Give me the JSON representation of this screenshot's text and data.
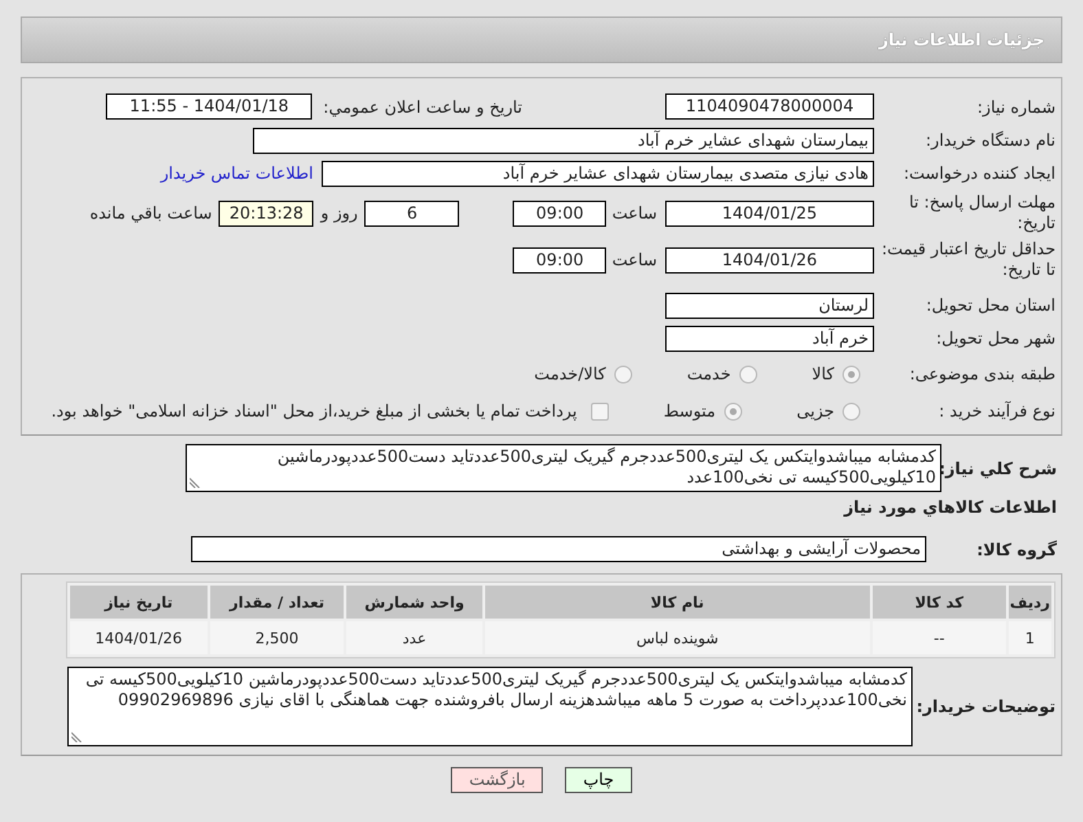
{
  "header": {
    "title": "جزئیات اطلاعات نیاز"
  },
  "need_number": {
    "label": "شماره نیاز:",
    "value": "1104090478000004"
  },
  "announce": {
    "label": "تاریخ و ساعت اعلان عمومي:",
    "value": "1404/01/18 - 11:55"
  },
  "buyer_org": {
    "label": "نام دستگاه خریدار:",
    "value": "بیمارستان شهدای عشایر خرم آباد"
  },
  "requester": {
    "label": "ایجاد کننده درخواست:",
    "value": "هادی نیازی متصدی بیمارستان شهدای عشایر خرم آباد",
    "contact_link": "اطلاعات تماس خریدار"
  },
  "reply_deadline": {
    "label": "مهلت ارسال پاسخ: تا تاریخ:",
    "date": "1404/01/25",
    "time_label": "ساعت",
    "time": "09:00",
    "days": "6",
    "days_label": "روز و",
    "remaining": "20:13:28",
    "remaining_label": "ساعت باقي مانده"
  },
  "price_validity": {
    "label": "حداقل تاریخ اعتبار قیمت: تا تاریخ:",
    "date": "1404/01/26",
    "time_label": "ساعت",
    "time": "09:00"
  },
  "province": {
    "label": "استان محل تحویل:",
    "value": "لرستان"
  },
  "city": {
    "label": "شهر محل تحویل:",
    "value": "خرم آباد"
  },
  "category": {
    "label": "طبقه بندی موضوعی:",
    "options": [
      {
        "label": "کالا",
        "selected": true
      },
      {
        "label": "خدمت",
        "selected": false
      },
      {
        "label": "کالا/خدمت",
        "selected": false
      }
    ]
  },
  "purchase_type": {
    "label": "نوع فرآیند خرید :",
    "options": [
      {
        "label": "جزیی",
        "selected": false
      },
      {
        "label": "متوسط",
        "selected": true
      }
    ],
    "treasury": {
      "label": "پرداخت تمام یا بخشی از مبلغ خرید،از محل \"اسناد خزانه اسلامی\" خواهد بود.",
      "checked": false
    }
  },
  "description": {
    "label": "شرح کلي نیاز:",
    "value": "کدمشابه میباشدوایتکس یک لیتری500عددجرم گیریک لیتری500عددتاید دست500عددپودرماشین 10کیلویی500کیسه تی نخی100عدد"
  },
  "items_title": "اطلاعات کالاهاي مورد نیاز",
  "goods_group": {
    "label": "گروه کالا:",
    "value": "محصولات آرایشی و بهداشتی"
  },
  "table": {
    "columns": [
      "ردیف",
      "کد کالا",
      "نام کالا",
      "واحد شمارش",
      "تعداد / مقدار",
      "تاریخ نیاز"
    ],
    "rows": [
      [
        "1",
        "--",
        "شوینده لباس",
        "عدد",
        "2,500",
        "1404/01/26"
      ]
    ]
  },
  "buyer_notes": {
    "label": "توضیحات خریدار:",
    "value": "کدمشابه میباشدوایتکس یک لیتری500عددجرم گیریک لیتری500عددتاید دست500عددپودرماشین 10کیلویی500کیسه تی نخی100عددپرداخت به صورت 5 ماهه میباشدهزینه ارسال بافروشنده جهت هماهنگی با اقای نیازی 09902969896"
  },
  "buttons": [
    {
      "label": "چاپ",
      "kind": "print"
    },
    {
      "label": "بازگشت",
      "kind": "back"
    }
  ]
}
